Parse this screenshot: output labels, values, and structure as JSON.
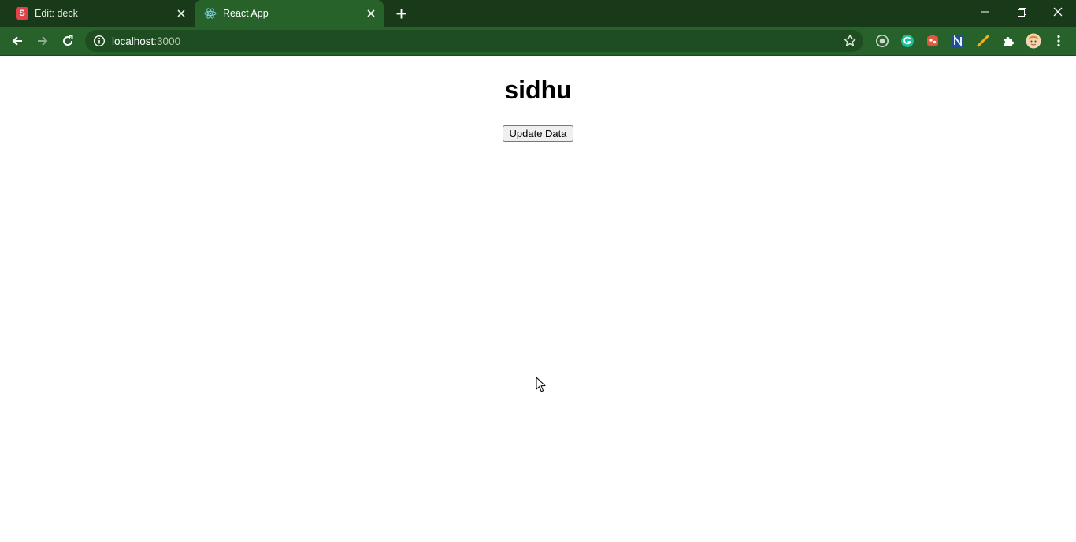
{
  "browser": {
    "tabs": [
      {
        "title": "Edit: deck",
        "favicon": "s-letter-icon",
        "favicon_letter": "S",
        "active": false
      },
      {
        "title": "React App",
        "favicon": "react-icon",
        "active": true
      }
    ],
    "address": {
      "host": "localhost",
      "port": ":3000"
    },
    "colors": {
      "titlebar": "#183a18",
      "toolbar": "#27622b",
      "omnibox": "#1e4d21"
    }
  },
  "page": {
    "heading": "sidhu",
    "button_label": "Update Data"
  }
}
